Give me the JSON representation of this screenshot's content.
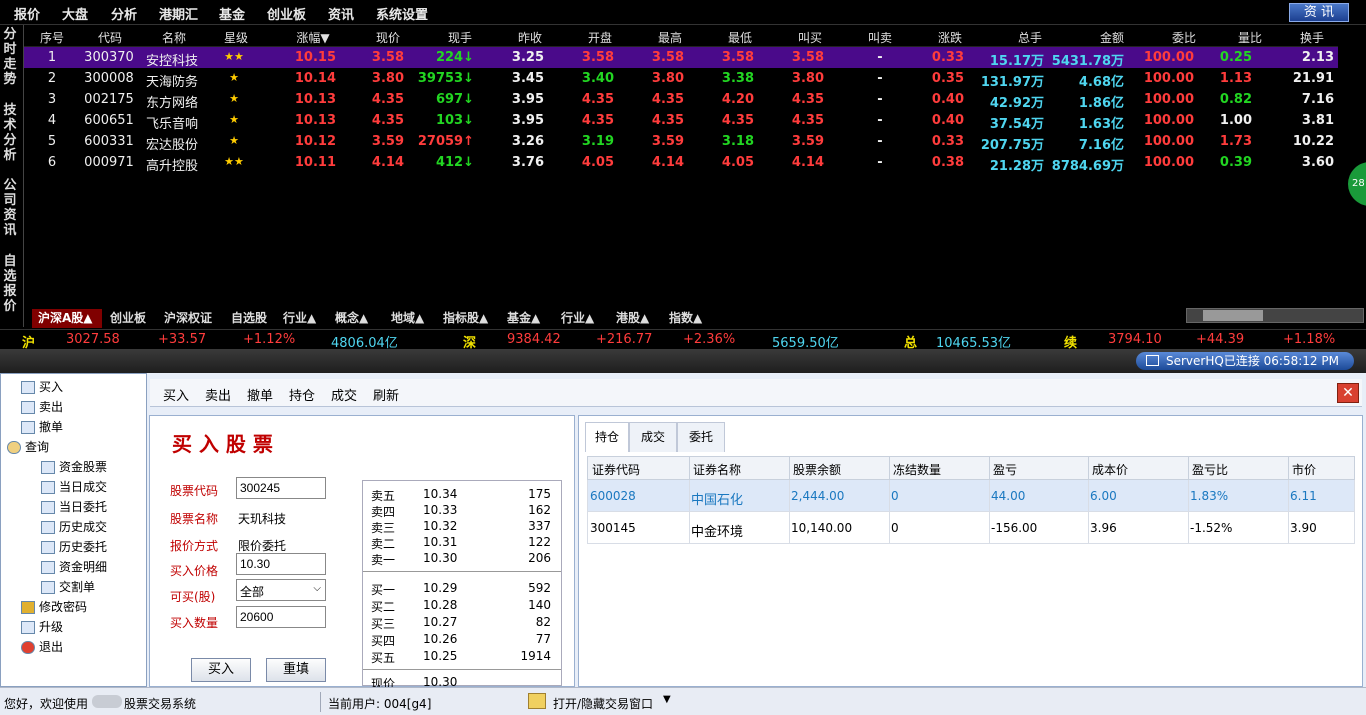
{
  "menu": [
    "报价",
    "大盘",
    "分析",
    "港期汇",
    "基金",
    "创业板",
    "资讯",
    "系统设置"
  ],
  "menu_right": "资 讯",
  "left_tabs": [
    "分时走势",
    "技术分析",
    "公司资讯",
    "自选报价"
  ],
  "columns": [
    "序号",
    "代码",
    "名称",
    "星级",
    "涨幅▼",
    "现价",
    "现手",
    "昨收",
    "开盘",
    "最高",
    "最低",
    "叫买",
    "叫卖",
    "涨跌",
    "总手",
    "金额",
    "委比",
    "量比",
    "换手"
  ],
  "rows": [
    {
      "no": "1",
      "code": "300370",
      "name": "安控科技",
      "stars": "★★",
      "chg_pct": "10.15",
      "price": "3.58",
      "vol": "224↓",
      "prev": "3.25",
      "open": "3.58",
      "high": "3.58",
      "low": "3.58",
      "bid": "3.58",
      "ask": "-",
      "chg": "0.33",
      "total": "15.17万",
      "amount": "5431.78万",
      "wb": "100.00",
      "lb": "0.25",
      "hs": "2.13"
    },
    {
      "no": "2",
      "code": "300008",
      "name": "天海防务",
      "stars": "★",
      "chg_pct": "10.14",
      "price": "3.80",
      "vol": "39753↓",
      "prev": "3.45",
      "open": "3.40",
      "high": "3.80",
      "low": "3.38",
      "bid": "3.80",
      "ask": "-",
      "chg": "0.35",
      "total": "131.97万",
      "amount": "4.68亿",
      "wb": "100.00",
      "lb": "1.13",
      "hs": "21.91"
    },
    {
      "no": "3",
      "code": "002175",
      "name": "东方网络",
      "stars": "★",
      "chg_pct": "10.13",
      "price": "4.35",
      "vol": "697↓",
      "prev": "3.95",
      "open": "4.35",
      "high": "4.35",
      "low": "4.20",
      "bid": "4.35",
      "ask": "-",
      "chg": "0.40",
      "total": "42.92万",
      "amount": "1.86亿",
      "wb": "100.00",
      "lb": "0.82",
      "hs": "7.16"
    },
    {
      "no": "4",
      "code": "600651",
      "name": "飞乐音响",
      "stars": "★",
      "chg_pct": "10.13",
      "price": "4.35",
      "vol": "103↓",
      "prev": "3.95",
      "open": "4.35",
      "high": "4.35",
      "low": "4.35",
      "bid": "4.35",
      "ask": "-",
      "chg": "0.40",
      "total": "37.54万",
      "amount": "1.63亿",
      "wb": "100.00",
      "lb": "1.00",
      "hs": "3.81"
    },
    {
      "no": "5",
      "code": "600331",
      "name": "宏达股份",
      "stars": "★",
      "chg_pct": "10.12",
      "price": "3.59",
      "vol": "27059↑",
      "prev": "3.26",
      "open": "3.19",
      "high": "3.59",
      "low": "3.18",
      "bid": "3.59",
      "ask": "-",
      "chg": "0.33",
      "total": "207.75万",
      "amount": "7.16亿",
      "wb": "100.00",
      "lb": "1.73",
      "hs": "10.22"
    },
    {
      "no": "6",
      "code": "000971",
      "name": "高升控股",
      "stars": "★★",
      "chg_pct": "10.11",
      "price": "4.14",
      "vol": "412↓",
      "prev": "3.76",
      "open": "4.05",
      "high": "4.14",
      "low": "4.05",
      "bid": "4.14",
      "ask": "-",
      "chg": "0.38",
      "total": "21.28万",
      "amount": "8784.69万",
      "wb": "100.00",
      "lb": "0.39",
      "hs": "3.60"
    }
  ],
  "side_circle": "28",
  "bottom_tabs": [
    "沪深A股▲",
    "创业板",
    "沪深权证",
    "自选股",
    "行业▲",
    "概念▲",
    "地域▲",
    "指标股▲",
    "基金▲",
    "行业▲",
    "港股▲",
    "指数▲"
  ],
  "index": {
    "sh_label": "沪",
    "sh_val": "3027.58",
    "sh_chg": "+33.57",
    "sh_pct": "+1.12%",
    "sh_amt": "4806.04亿",
    "sz_label": "深",
    "sz_val": "9384.42",
    "sz_chg": "+216.77",
    "sz_pct": "+2.36%",
    "sz_amt": "5659.50亿",
    "tot_label": "总",
    "tot_amt": "10465.53亿",
    "cy_label": "续",
    "cy_val": "3794.10",
    "cy_chg": "+44.39",
    "cy_pct": "+1.18%"
  },
  "connection": "ServerHQ已连接  06:58:12 PM",
  "tree": [
    "买入",
    "卖出",
    "撤单",
    "查询",
    "资金股票",
    "当日成交",
    "当日委托",
    "历史成交",
    "历史委托",
    "资金明细",
    "交割单",
    "修改密码",
    "升级",
    "退出"
  ],
  "toolbar": [
    "买入",
    "卖出",
    "撤单",
    "持仓",
    "成交",
    "刷新"
  ],
  "form": {
    "title": "买 入 股 票",
    "code_label": "股票代码",
    "code": "300245",
    "name_label": "股票名称",
    "name": "天玑科技",
    "mode_label": "报价方式",
    "mode": "限价委托",
    "price_label": "买入价格",
    "price": "10.30",
    "avail_label": "可买(股)",
    "avail": "全部",
    "qty_label": "买入数量",
    "qty": "20600",
    "buy_btn": "买入",
    "reset_btn": "重填"
  },
  "book": {
    "sell": [
      [
        "卖五",
        "10.34",
        "175"
      ],
      [
        "卖四",
        "10.33",
        "162"
      ],
      [
        "卖三",
        "10.32",
        "337"
      ],
      [
        "卖二",
        "10.31",
        "122"
      ],
      [
        "卖一",
        "10.30",
        "206"
      ]
    ],
    "buy": [
      [
        "买一",
        "10.29",
        "592"
      ],
      [
        "买二",
        "10.28",
        "140"
      ],
      [
        "买三",
        "10.27",
        "82"
      ],
      [
        "买四",
        "10.26",
        "77"
      ],
      [
        "买五",
        "10.25",
        "1914"
      ]
    ],
    "last_label": "现价",
    "last": "10.30"
  },
  "hold_tabs": [
    "持仓",
    "成交",
    "委托"
  ],
  "hold_cols": [
    "证券代码",
    "证券名称",
    "股票余额",
    "冻结数量",
    "盈亏",
    "成本价",
    "盈亏比",
    "市价"
  ],
  "hold_rows": [
    [
      "600028",
      "中国石化",
      "2,444.00",
      "0",
      "44.00",
      "6.00",
      "1.83%",
      "6.11"
    ],
    [
      "300145",
      "中金环境",
      "10,140.00",
      "0",
      "-156.00",
      "3.96",
      "-1.52%",
      "3.90"
    ]
  ],
  "footer": {
    "welcome": "您好，欢迎使用",
    "system": "股票交易系统",
    "user": "当前用户: 004[g4]",
    "toggle": "打开/隐藏交易窗口"
  }
}
